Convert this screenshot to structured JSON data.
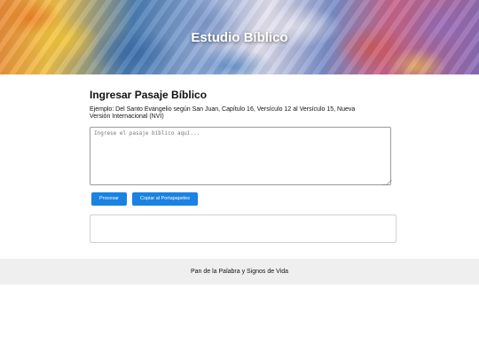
{
  "header": {
    "title": "Estudio Bíblico"
  },
  "main": {
    "section_title": "Ingresar Pasaje Bíblico",
    "example_text": "Ejemplo: Del Santo Evangelio según San Juan, Capítulo 16, Versículo 12 al Versículo 15, Nueva Versión Internacional (NVI)",
    "input": {
      "placeholder": "Ingrese el pasaje bíblico aquí...",
      "value": ""
    },
    "buttons": {
      "process_label": "Procesar",
      "copy_label": "Copiar al Portapapeles"
    },
    "result": ""
  },
  "footer": {
    "text": "Pan de la Palabra y Signos de Vida"
  },
  "colors": {
    "button_bg": "#1a82e2",
    "footer_bg": "#efefef"
  }
}
